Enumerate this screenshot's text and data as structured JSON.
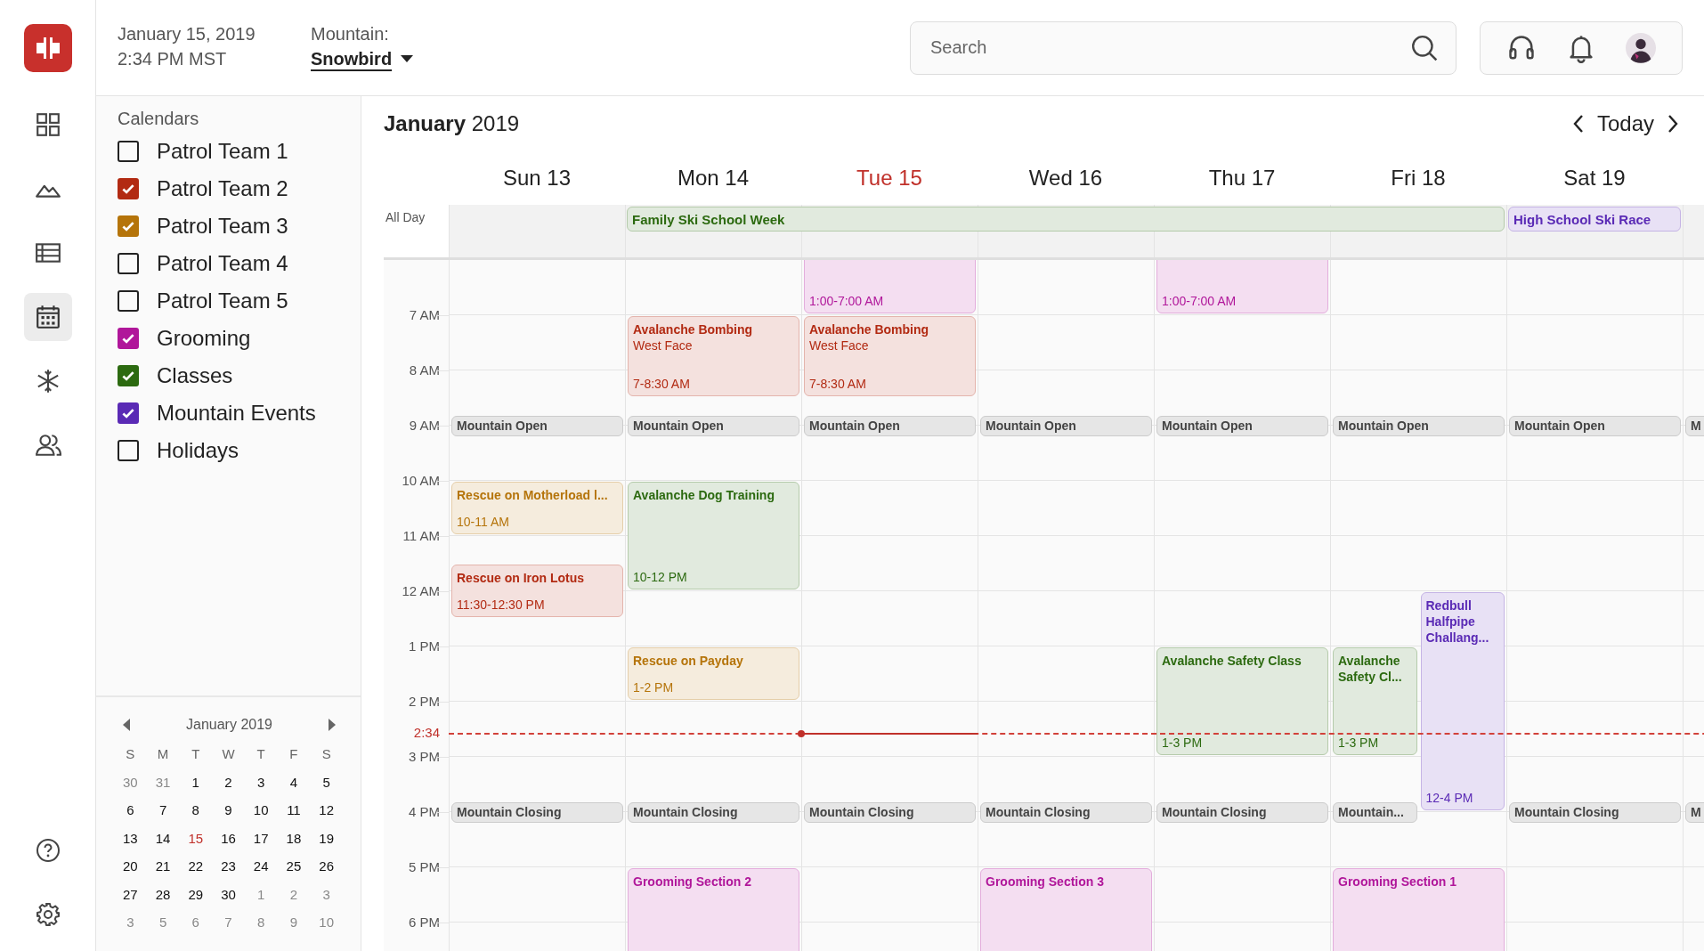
{
  "rail": {
    "items": [
      {
        "kind": "dashboard",
        "selected": false
      },
      {
        "kind": "mountain",
        "selected": false
      },
      {
        "kind": "list",
        "selected": false
      },
      {
        "kind": "calendar",
        "selected": true
      },
      {
        "kind": "snow",
        "selected": false
      },
      {
        "kind": "people",
        "selected": false
      }
    ],
    "bottom_items": [
      {
        "kind": "help"
      },
      {
        "kind": "settings"
      }
    ]
  },
  "header": {
    "date": "January 15, 2019",
    "time": "2:34 PM MST",
    "mountain_label": "Mountain:",
    "mountain": "Snowbird",
    "search": {
      "placeholder": "Search"
    }
  },
  "calendars": {
    "title": "Calendars",
    "items": [
      {
        "label": "Patrol Team 1",
        "checked": false
      },
      {
        "label": "Patrol Team 2",
        "checked": true,
        "color": "#b22a12"
      },
      {
        "label": "Patrol Team 3",
        "checked": true,
        "color": "#b5740a"
      },
      {
        "label": "Patrol Team 4",
        "checked": false
      },
      {
        "label": "Patrol Team 5",
        "checked": false
      },
      {
        "label": "Grooming",
        "checked": true,
        "color": "#b0169a"
      },
      {
        "label": "Classes",
        "checked": true,
        "color": "#2c6a10"
      },
      {
        "label": "Mountain Events",
        "checked": true,
        "color": "#5a2ab5"
      },
      {
        "label": "Holidays",
        "checked": false
      }
    ]
  },
  "mini_calendar": {
    "title": "January 2019",
    "weekdays": [
      "S",
      "M",
      "T",
      "W",
      "T",
      "F",
      "S"
    ],
    "weeks": [
      [
        {
          "d": "30",
          "muted": true,
          "today": false
        },
        {
          "d": "31",
          "muted": true,
          "today": false
        },
        {
          "d": "1",
          "muted": false,
          "today": false
        },
        {
          "d": "2",
          "muted": false,
          "today": false
        },
        {
          "d": "3",
          "muted": false,
          "today": false
        },
        {
          "d": "4",
          "muted": false,
          "today": false
        },
        {
          "d": "5",
          "muted": false,
          "today": false
        }
      ],
      [
        {
          "d": "6",
          "muted": false,
          "today": false
        },
        {
          "d": "7",
          "muted": false,
          "today": false
        },
        {
          "d": "8",
          "muted": false,
          "today": false
        },
        {
          "d": "9",
          "muted": false,
          "today": false
        },
        {
          "d": "10",
          "muted": false,
          "today": false
        },
        {
          "d": "11",
          "muted": false,
          "today": false
        },
        {
          "d": "12",
          "muted": false,
          "today": false
        }
      ],
      [
        {
          "d": "13",
          "muted": false,
          "today": false
        },
        {
          "d": "14",
          "muted": false,
          "today": false
        },
        {
          "d": "15",
          "muted": false,
          "today": true
        },
        {
          "d": "16",
          "muted": false,
          "today": false
        },
        {
          "d": "17",
          "muted": false,
          "today": false
        },
        {
          "d": "18",
          "muted": false,
          "today": false
        },
        {
          "d": "19",
          "muted": false,
          "today": false
        }
      ],
      [
        {
          "d": "20",
          "muted": false,
          "today": false
        },
        {
          "d": "21",
          "muted": false,
          "today": false
        },
        {
          "d": "22",
          "muted": false,
          "today": false
        },
        {
          "d": "23",
          "muted": false,
          "today": false
        },
        {
          "d": "24",
          "muted": false,
          "today": false
        },
        {
          "d": "25",
          "muted": false,
          "today": false
        },
        {
          "d": "26",
          "muted": false,
          "today": false
        }
      ],
      [
        {
          "d": "27",
          "muted": false,
          "today": false
        },
        {
          "d": "28",
          "muted": false,
          "today": false
        },
        {
          "d": "29",
          "muted": false,
          "today": false
        },
        {
          "d": "30",
          "muted": false,
          "today": false
        },
        {
          "d": "1",
          "muted": true,
          "today": false
        },
        {
          "d": "2",
          "muted": true,
          "today": false
        },
        {
          "d": "3",
          "muted": true,
          "today": false
        }
      ],
      [
        {
          "d": "3",
          "muted": true,
          "today": false
        },
        {
          "d": "5",
          "muted": true,
          "today": false
        },
        {
          "d": "6",
          "muted": true,
          "today": false
        },
        {
          "d": "7",
          "muted": true,
          "today": false
        },
        {
          "d": "8",
          "muted": true,
          "today": false
        },
        {
          "d": "9",
          "muted": true,
          "today": false
        },
        {
          "d": "10",
          "muted": true,
          "today": false
        }
      ]
    ]
  },
  "week": {
    "month": "January",
    "year": "2019",
    "today_button": "Today",
    "all_day_label": "All Day",
    "hours": [
      "7 AM",
      "8 AM",
      "9 AM",
      "10 AM",
      "11 AM",
      "12 AM",
      "1 PM",
      "2 PM",
      "3 PM",
      "4 PM",
      "5 PM",
      "6 PM"
    ],
    "now_label": "2:34",
    "all_day_events": [
      {
        "title": "Family Ski School Week",
        "color": "#2c6a10"
      },
      {
        "title": "High School Ski Race",
        "color": "#5a2ab5"
      }
    ],
    "days": [
      {
        "label": "Sun 13",
        "today": false,
        "events": [
          {
            "title": "Mountain Open",
            "color": "#444444"
          },
          {
            "title": "Rescue on Motherload l...",
            "time": "10-11 AM",
            "color": "#b5740a"
          },
          {
            "title": "Rescue on Iron Lotus",
            "time": "11:30-12:30 PM",
            "color": "#b22a12"
          },
          {
            "title": "Mountain Closing",
            "color": "#444444"
          }
        ]
      },
      {
        "label": "Mon 14",
        "today": false,
        "events": [
          {
            "title": "Avalanche Bombing",
            "subtitle": "West Face",
            "time": "7-8:30 AM",
            "color": "#b22a12"
          },
          {
            "title": "Mountain Open",
            "color": "#444444"
          },
          {
            "title": "Avalanche Dog Training",
            "time": "10-12 PM",
            "color": "#2c6a10"
          },
          {
            "title": "Rescue on Payday",
            "time": "1-2 PM",
            "color": "#b5740a"
          },
          {
            "title": "Mountain Closing",
            "color": "#444444"
          },
          {
            "title": "Grooming Section 2",
            "color": "#b0169a"
          }
        ]
      },
      {
        "label": "Tue 15",
        "today": true,
        "events": [
          {
            "time": "1:00-7:00 AM",
            "color": "#b0169a"
          },
          {
            "title": "Avalanche Bombing",
            "subtitle": "West Face",
            "time": "7-8:30 AM",
            "color": "#b22a12"
          },
          {
            "title": "Mountain Open",
            "color": "#444444"
          },
          {
            "title": "Mountain Closing",
            "color": "#444444"
          }
        ]
      },
      {
        "label": "Wed 16",
        "today": false,
        "events": [
          {
            "title": "Mountain Open",
            "color": "#444444"
          },
          {
            "title": "Mountain Closing",
            "color": "#444444"
          },
          {
            "title": "Grooming Section 3",
            "color": "#b0169a"
          }
        ]
      },
      {
        "label": "Thu 17",
        "today": false,
        "events": [
          {
            "time": "1:00-7:00 AM",
            "color": "#b0169a"
          },
          {
            "title": "Mountain Open",
            "color": "#444444"
          },
          {
            "title": "Avalanche Safety Class",
            "time": "1-3 PM",
            "color": "#2c6a10"
          },
          {
            "title": "Mountain Closing",
            "color": "#444444"
          }
        ]
      },
      {
        "label": "Fri 18",
        "today": false,
        "events": [
          {
            "title": "Mountain Open",
            "color": "#444444"
          },
          {
            "title": "Avalanche Safety Cl...",
            "time": "1-3 PM",
            "color": "#2c6a10"
          },
          {
            "title": "Redbull Halfpipe Challang...",
            "time": "12-4 PM",
            "color": "#5a2ab5"
          },
          {
            "title": "Mountain...",
            "color": "#444444"
          },
          {
            "title": "Grooming Section 1",
            "color": "#b0169a"
          }
        ]
      },
      {
        "label": "Sat 19",
        "today": false,
        "events": [
          {
            "title": "Mountain Open",
            "color": "#444444"
          },
          {
            "title": "Mountain Closing",
            "color": "#444444"
          }
        ]
      },
      {
        "events": [
          {
            "title": "M",
            "color": "#444444"
          },
          {
            "title": "M",
            "color": "#444444"
          }
        ]
      }
    ]
  }
}
